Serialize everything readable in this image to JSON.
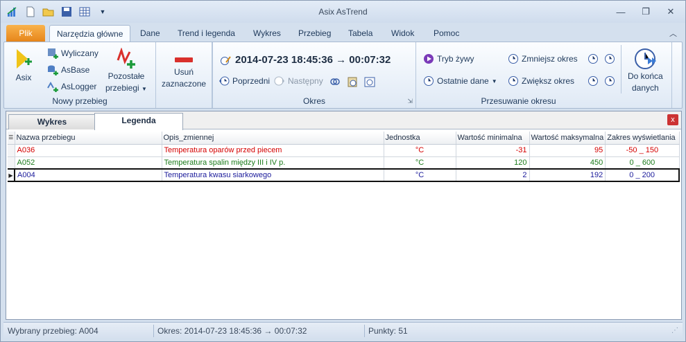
{
  "window": {
    "title": "Asix AsTrend"
  },
  "qat": {
    "icons": [
      "app-icon",
      "new-file-icon",
      "open-folder-icon",
      "save-icon",
      "table-icon",
      "dropdown-arrow-icon"
    ]
  },
  "tabs": {
    "file": "Plik",
    "items": [
      "Narzędzia główne",
      "Dane",
      "Trend i legenda",
      "Wykres",
      "Przebieg",
      "Tabela",
      "Widok",
      "Pomoc"
    ]
  },
  "ribbon": {
    "nowy": {
      "label": "Nowy przebieg",
      "asix": "Asix",
      "wyliczany": "Wyliczany",
      "asbase": "AsBase",
      "aslogger": "AsLogger",
      "pozostale1": "Pozostałe",
      "pozostale2": "przebiegi",
      "usun1": "Usuń",
      "usun2": "zaznaczone"
    },
    "okres": {
      "label": "Okres",
      "range": "2014-07-23  18:45:36 → 00:07:32",
      "prev": "Poprzedni",
      "next": "Następny"
    },
    "przes": {
      "label": "Przesuwanie okresu",
      "live": "Tryb żywy",
      "last": "Ostatnie dane",
      "dec": "Zmniejsz okres",
      "inc": "Zwiększ okres",
      "end1": "Do końca",
      "end2": "danych"
    }
  },
  "subtabs": {
    "wykres": "Wykres",
    "legenda": "Legenda"
  },
  "table": {
    "headers": [
      "Nazwa przebiegu",
      "Opis_zmiennej",
      "Jednostka",
      "Wartość minimalna",
      "Wartość maksymalna",
      "Zakres wyświetlania"
    ],
    "rows": [
      {
        "name": "A036",
        "desc": "Temperatura oparów przed piecem",
        "unit": "°C",
        "min": "-31",
        "max": "95",
        "range": "-50 _ 150",
        "color": "#d40000"
      },
      {
        "name": "A052",
        "desc": "Temperatura spalin między III i IV p.",
        "unit": "°C",
        "min": "120",
        "max": "450",
        "range": "0 _ 600",
        "color": "#1a7a1a"
      },
      {
        "name": "A004",
        "desc": "Temperatura kwasu siarkowego",
        "unit": "°C",
        "min": "2",
        "max": "192",
        "range": "0 _ 200",
        "color": "#1a1a9a"
      }
    ]
  },
  "status": {
    "selected": "Wybrany przebieg: A004",
    "period": "Okres: 2014-07-23  18:45:36 → 00:07:32",
    "points": "Punkty: 51"
  },
  "colors": {
    "accent": "#e6851a",
    "asix_yellow": "#f0c419",
    "remove_red": "#d9302c"
  }
}
